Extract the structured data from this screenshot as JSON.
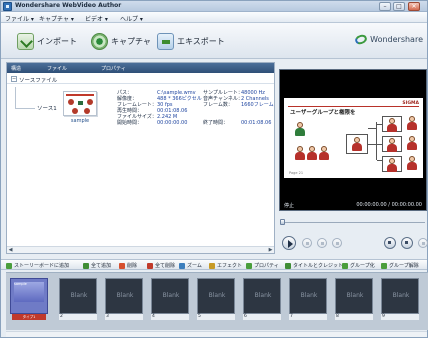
{
  "window": {
    "title": "Wondershare WebVideo Author",
    "buttons": {
      "minimize": "–",
      "maximize": "□",
      "close": "✕"
    }
  },
  "menu": {
    "items": [
      {
        "label": "ファイル ▾"
      },
      {
        "label": "キャプチャ ▾"
      },
      {
        "label": "ビデオ ▾"
      },
      {
        "label": "ヘルプ ▾"
      }
    ]
  },
  "toolbar": {
    "import_label": "インポート",
    "capture_label": "キャプチャ",
    "export_label": "エキスポート",
    "brand": "Wondershare"
  },
  "library": {
    "columns": [
      "構造",
      "ファイル",
      "プロパティ"
    ],
    "group_toggle": "−",
    "group_label": "ソースファイル",
    "tree_label": "ソース1",
    "thumb_caption": "sample",
    "props_left_labels": [
      "パス：",
      "解像度：",
      "フレームレート：",
      "再生時間：",
      "ファイルサイズ：",
      "開始時間："
    ],
    "props_left_values": [
      "C:\\sample.wmv",
      "488 * 366ピクセル",
      "30 fps",
      "00:01:08.06",
      "2.242 M",
      "00:00:00.00"
    ],
    "props_right_labels": [
      "サンプルレート：",
      "音声チャンネル：",
      "フレーム数：",
      "",
      "",
      "終了時間："
    ],
    "props_right_values": [
      "48000 Hz",
      "2 Channels",
      "1660フレーム",
      "",
      "",
      "00:01:08.06"
    ],
    "scroll_left": "◀",
    "scroll_right": "▶"
  },
  "preview": {
    "slide_brand": "SIGMA",
    "slide_title": "ユーザーグループと権限を",
    "slide_foot": "Page 21",
    "status": "停止",
    "timecode": "00:00:00.00 / 00:00:00.00"
  },
  "actions": {
    "items": [
      {
        "label": "ストーリーボードに追加",
        "color": "#4a9e3c"
      },
      {
        "label": "全て追加",
        "color": "#3f8d35"
      },
      {
        "label": "削除",
        "color": "#d6502f"
      },
      {
        "label": "全て削除",
        "color": "#c03a2b"
      },
      {
        "label": "ズーム",
        "color": "#3c7fbd"
      },
      {
        "label": "エフェクト",
        "color": "#c79a26"
      },
      {
        "label": "プロパティ",
        "color": "#4a9e3c"
      },
      {
        "label": "タイトルとクレジット",
        "color": "#3f8d35"
      },
      {
        "label": "グループ化",
        "color": "#4a9e3c"
      },
      {
        "label": "グループ解除",
        "color": "#4a9e3c"
      }
    ]
  },
  "storyboard": {
    "first": {
      "tag": "sample",
      "label": "タイプ1"
    },
    "cells": [
      {
        "text": "Blank",
        "num": "2"
      },
      {
        "text": "Blank",
        "num": "3"
      },
      {
        "text": "Blank",
        "num": "4"
      },
      {
        "text": "Blank",
        "num": "5"
      },
      {
        "text": "Blank",
        "num": "6"
      },
      {
        "text": "Blank",
        "num": "7"
      },
      {
        "text": "Blank",
        "num": "8"
      },
      {
        "text": "Blank",
        "num": "9"
      },
      {
        "text": "Blank",
        "num": "10"
      }
    ]
  }
}
